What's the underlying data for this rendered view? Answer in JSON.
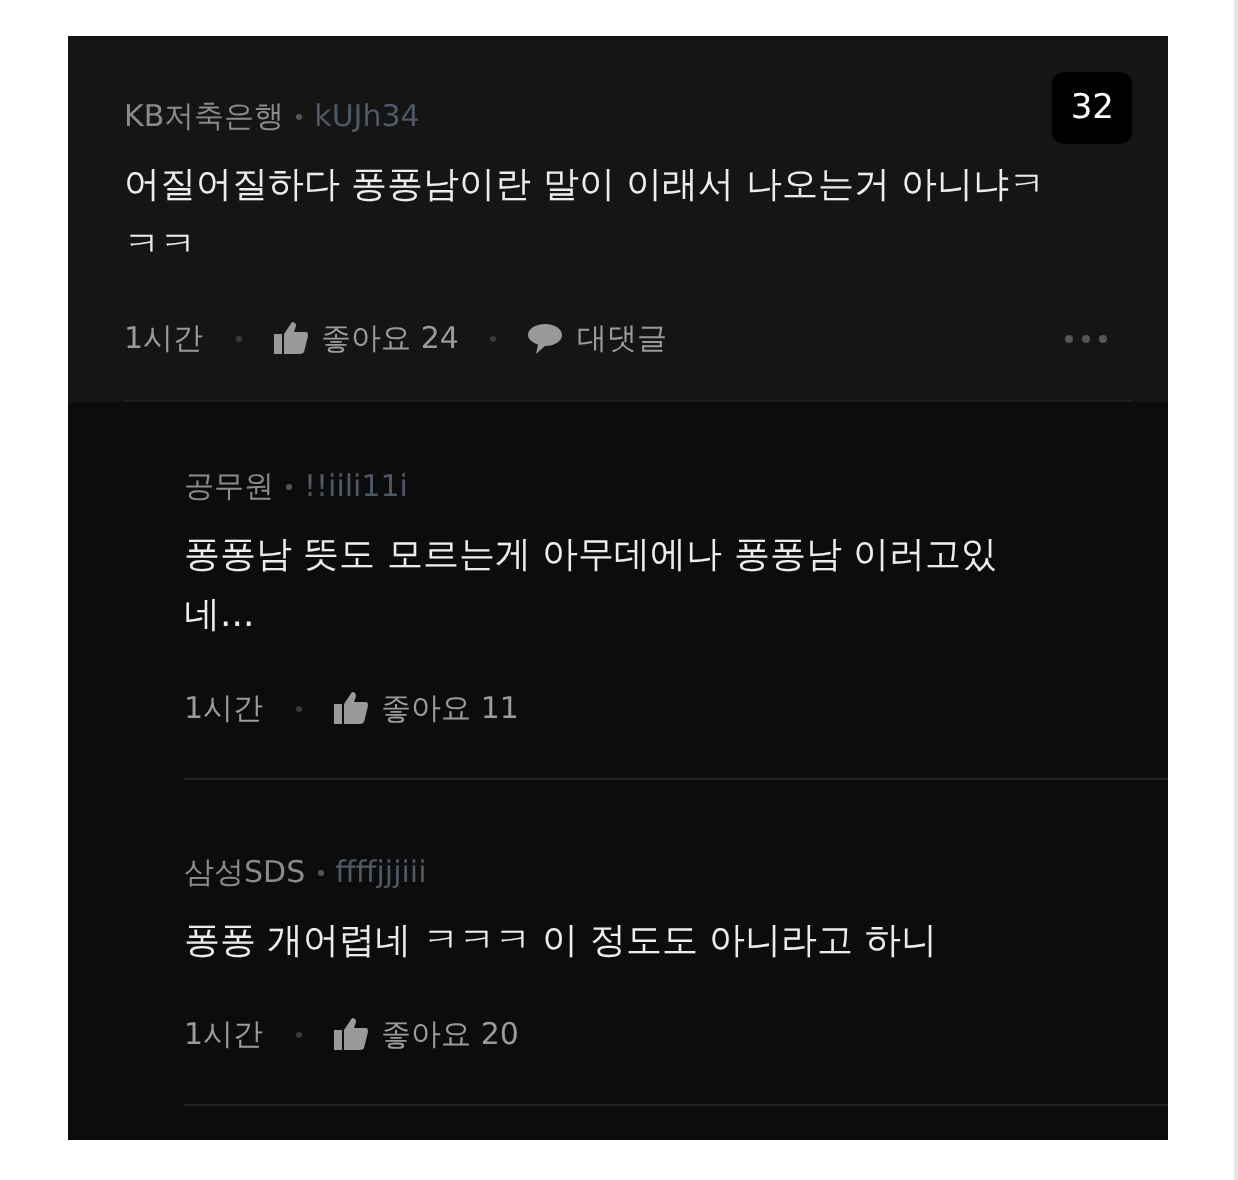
{
  "comment": {
    "author": "KB저축은행",
    "handle": "kUJh34",
    "badge": "32",
    "body": "어질어질하다 퐁퐁남이란 말이 이래서 나오는거 아니냐ㅋㅋㅋ",
    "time": "1시간",
    "likes": "좋아요 24",
    "reply_label": "대댓글",
    "replies": [
      {
        "author": "공무원",
        "handle": "!!iili11i",
        "body": "퐁퐁남 뜻도 모르는게 아무데에나 퐁퐁남 이러고있네...",
        "time": "1시간",
        "likes": "좋아요 11"
      },
      {
        "author": "삼성SDS",
        "handle": "ffffjjjiii",
        "body": "퐁퐁 개어렵네 ㅋㅋㅋ 이 정도도 아니라고 하니",
        "time": "1시간",
        "likes": "좋아요 20"
      }
    ]
  }
}
